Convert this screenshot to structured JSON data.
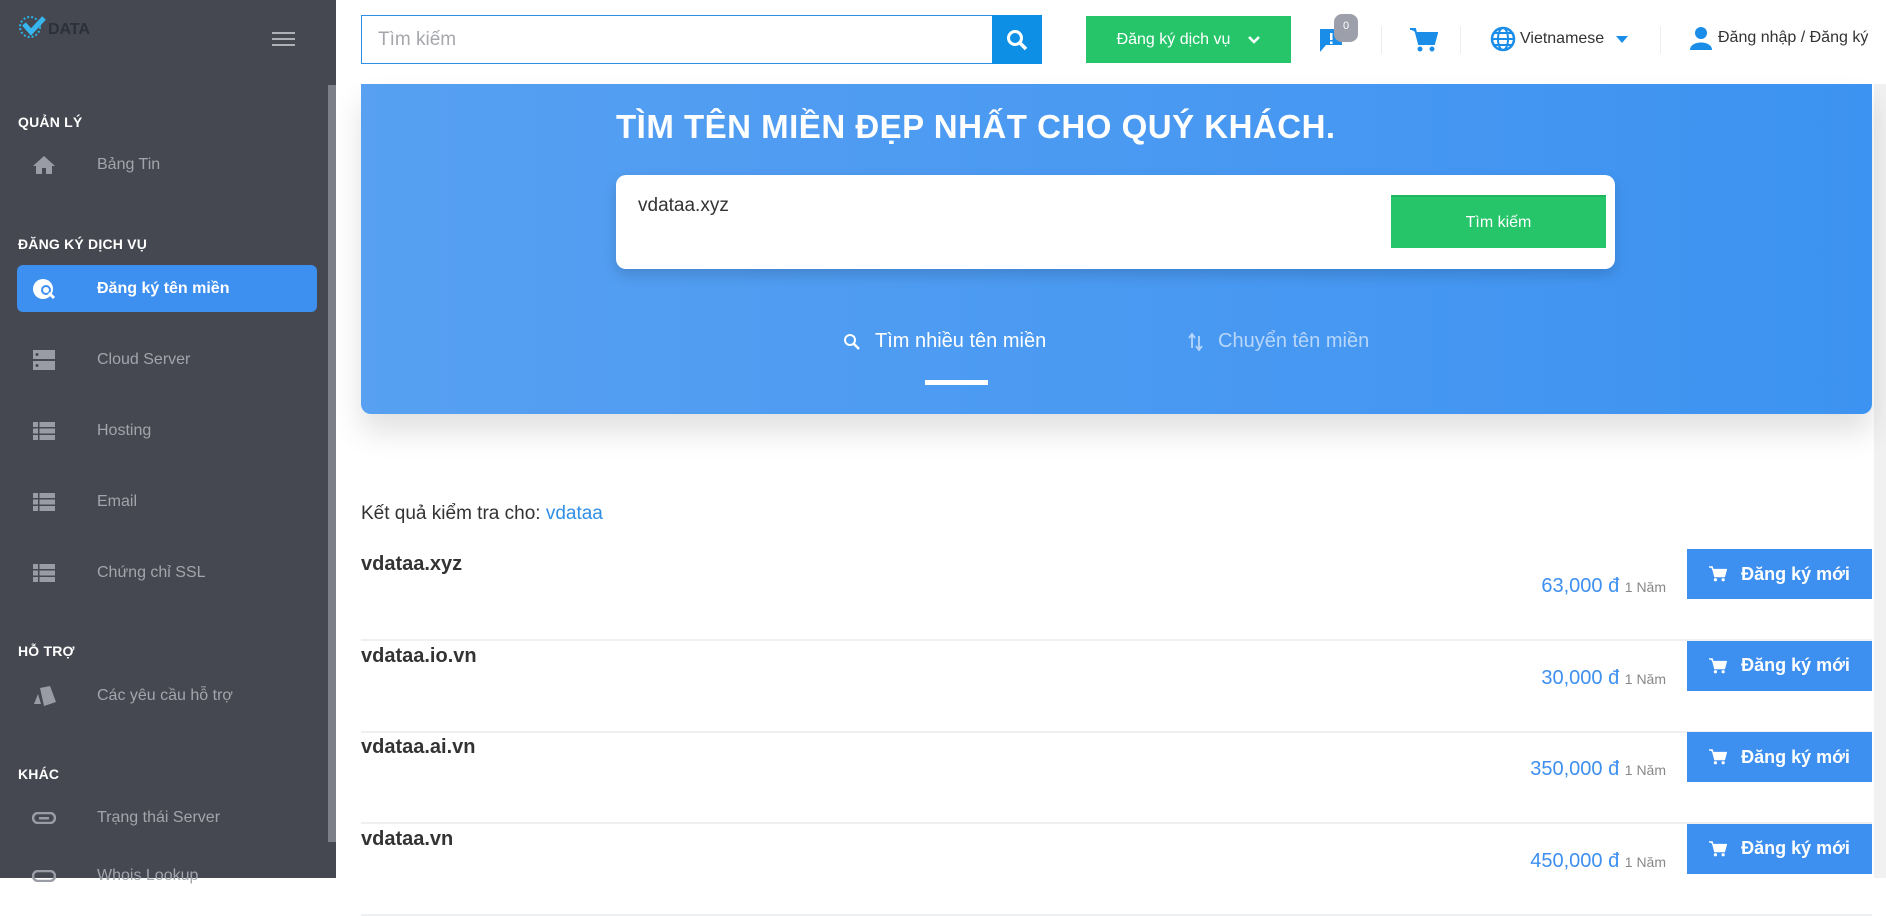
{
  "sidebar": {
    "logo_text": "DATA",
    "sections": {
      "manage": "QUẢN LÝ",
      "services": "ĐĂNG KÝ DỊCH VỤ",
      "support": "HỖ TRỢ",
      "other": "KHÁC"
    },
    "items": [
      {
        "label": "Bảng Tin",
        "icon": "home-icon"
      },
      {
        "label": "Đăng ký tên miền",
        "icon": "globe-search-icon",
        "active": true
      },
      {
        "label": "Cloud Server",
        "icon": "server-icon"
      },
      {
        "label": "Hosting",
        "icon": "list-icon"
      },
      {
        "label": "Email",
        "icon": "list-icon"
      },
      {
        "label": "Chứng chỉ SSL",
        "icon": "list-icon"
      },
      {
        "label": "Các yêu cầu hỗ trợ",
        "icon": "ticket-icon"
      },
      {
        "label": "Trạng thái Server",
        "icon": "link-icon"
      },
      {
        "label": "Whois Lookup",
        "icon": "link-icon"
      }
    ]
  },
  "header": {
    "search_placeholder": "Tìm kiếm",
    "register_service": "Đăng ký dịch vụ",
    "notification_count": "0",
    "language": "Vietnamese",
    "login": "Đăng nhập / Đăng ký"
  },
  "hero": {
    "title": "TÌM TÊN MIỀN ĐẸP NHẤT CHO QUÝ KHÁCH.",
    "domain_value": "vdataa.xyz",
    "search_button": "Tìm kiếm",
    "tabs": [
      {
        "label": "Tìm nhiều tên miền",
        "active": true
      },
      {
        "label": "Chuyển tên miền",
        "active": false
      }
    ]
  },
  "results": {
    "label": "Kết quả kiểm tra cho:",
    "query": "vdataa",
    "period": "1 Năm",
    "button": "Đăng ký mới",
    "rows": [
      {
        "domain": "vdataa.xyz",
        "price": "63,000 đ"
      },
      {
        "domain": "vdataa.io.vn",
        "price": "30,000 đ"
      },
      {
        "domain": "vdataa.ai.vn",
        "price": "350,000 đ"
      },
      {
        "domain": "vdataa.vn",
        "price": "450,000 đ"
      }
    ]
  },
  "colors": {
    "sidebar": "#464851",
    "accent": "#3d8ff0",
    "green": "#27c56a"
  }
}
